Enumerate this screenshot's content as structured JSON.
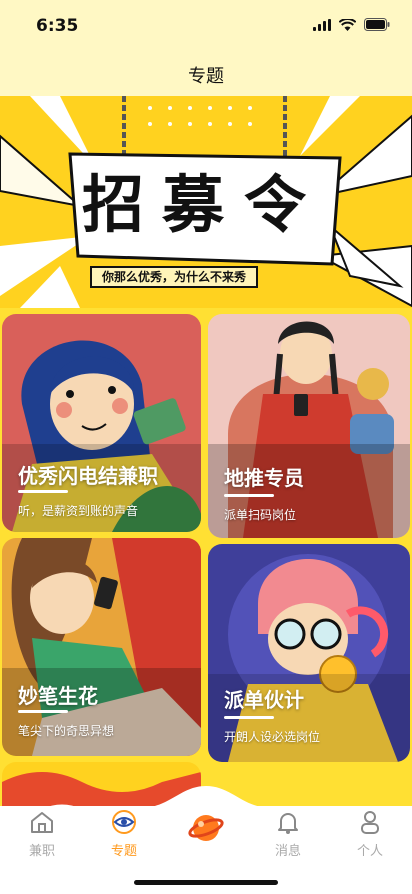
{
  "status": {
    "time": "6:35"
  },
  "nav": {
    "title": "专题"
  },
  "banner": {
    "words": [
      "招",
      "募",
      "令"
    ],
    "subtitle": "你那么优秀，为什么不来秀"
  },
  "cards": [
    {
      "title": "优秀闪电结兼职",
      "subtitle": "听，是薪资到账的声音"
    },
    {
      "title": "地推专员",
      "subtitle": "派单扫码岗位"
    },
    {
      "title": "妙笔生花",
      "subtitle": "笔尖下的奇思异想"
    },
    {
      "title": "派单伙计",
      "subtitle": "开朗人设必选岗位"
    }
  ],
  "tabs": [
    {
      "label": "兼职",
      "icon": "home-icon"
    },
    {
      "label": "专题",
      "icon": "eye-icon"
    },
    {
      "label": "",
      "icon": "planet-icon"
    },
    {
      "label": "消息",
      "icon": "bell-icon"
    },
    {
      "label": "个人",
      "icon": "person-icon"
    }
  ],
  "colors": {
    "accent": "#ff9a1e",
    "inactive": "#aaaaaa",
    "header_bg": "#fff8c4",
    "page_bg": "#ffe033"
  }
}
